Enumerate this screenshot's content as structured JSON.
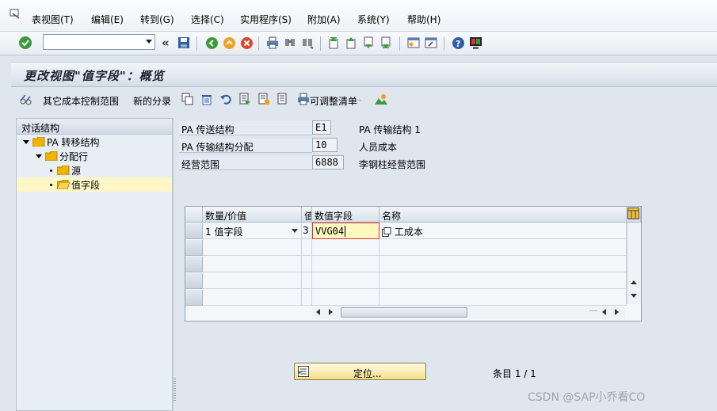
{
  "menu": {
    "items": [
      "表视图(T)",
      "编辑(E)",
      "转到(G)",
      "选择(C)",
      "实用程序(S)",
      "附加(A)",
      "系统(Y)",
      "帮助(H)"
    ]
  },
  "toolbar": {
    "command_value": "",
    "buttons": [
      "check-icon",
      "save-icon",
      "back-icon",
      "exit-icon",
      "cancel-icon",
      "print-icon",
      "find-icon",
      "find-next-icon",
      "first-page-icon",
      "prev-page-icon",
      "next-page-icon",
      "last-page-icon",
      "new-session-icon",
      "shortcut-icon",
      "help-icon",
      "customize-layout-icon"
    ]
  },
  "title": "更改视图\"值字段\"：概览",
  "app_toolbar": {
    "other_cost_control_area": "其它成本控制范围",
    "new_entries": "新的分录",
    "adjustable_list": "可调整清单"
  },
  "nav": {
    "header": "对话结构",
    "tree": [
      {
        "label": "PA 转移结构",
        "level": 0
      },
      {
        "label": "分配行",
        "level": 1
      },
      {
        "label": "源",
        "level": 2
      },
      {
        "label": "值字段",
        "level": 2,
        "selected": true
      }
    ]
  },
  "form": {
    "rows": [
      {
        "label": "PA 传送结构",
        "value": "E1",
        "text": "PA 传输结构 1"
      },
      {
        "label": "PA 传输结构分配",
        "value": "10",
        "text": "人员成本"
      },
      {
        "label": "经营范围",
        "value": "6888",
        "text": "李钢柱经营范围"
      }
    ]
  },
  "table": {
    "headers": [
      "数量/价值",
      "值",
      "数值字段",
      "名称"
    ],
    "rows": [
      {
        "qty_value": "1 值字段",
        "code": "3",
        "value_field": "VVG04",
        "name": "工成本"
      }
    ]
  },
  "position_button": "定位...",
  "entry_count": "条目 1 / 1",
  "watermark": "CSDN @SAP小乔看CO",
  "colors": {
    "background": "#dfe6ee",
    "selected_row": "#fff8c6",
    "folder": "#f0b400",
    "position_button": "#f3df8a"
  }
}
